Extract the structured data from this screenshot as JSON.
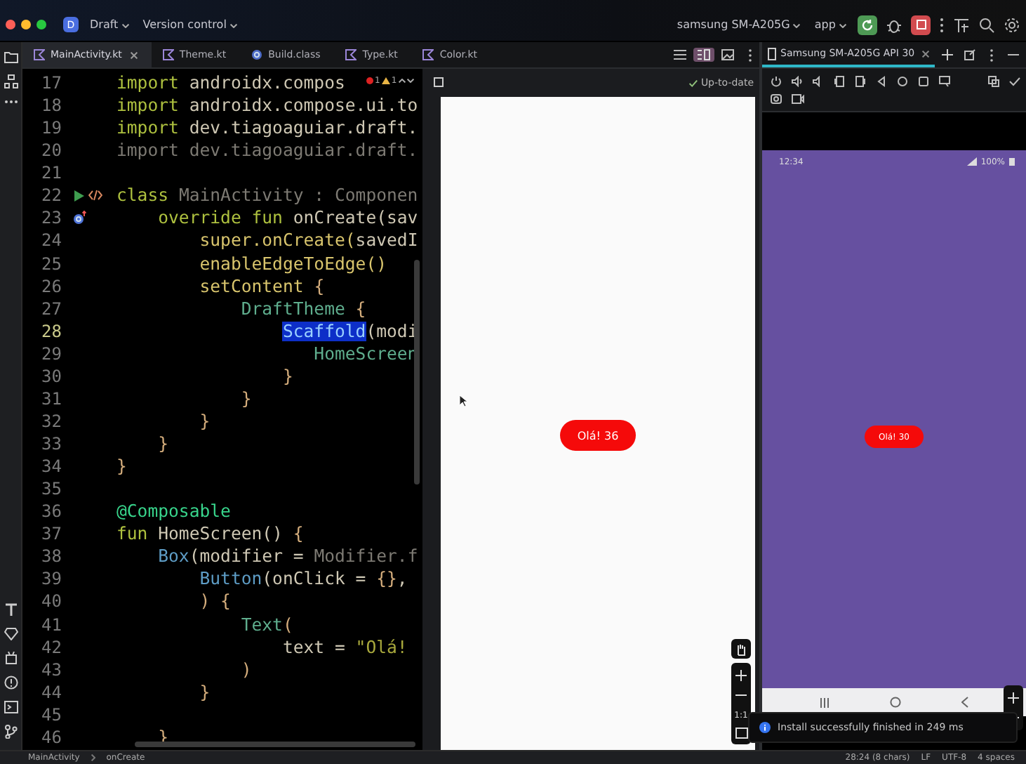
{
  "title_bar": {
    "project_badge": "D",
    "project": "Draft",
    "version_control": "Version control",
    "device": "samsung SM-A205G",
    "config": "app"
  },
  "tabs": [
    {
      "label": "MainActivity.kt",
      "kind": "kotlin",
      "selected": true
    },
    {
      "label": "Theme.kt",
      "kind": "kotlin",
      "selected": false
    },
    {
      "label": "Build.class",
      "kind": "class",
      "selected": false
    },
    {
      "label": "Type.kt",
      "kind": "kotlin",
      "selected": false
    },
    {
      "label": "Color.kt",
      "kind": "kotlin",
      "selected": false
    }
  ],
  "inspections": {
    "errors": "1",
    "warnings": "1"
  },
  "code": [
    {
      "number": "17",
      "tokens": [
        {
          "text": "import",
          "kind": "kw"
        },
        {
          "text": " androidx.compos",
          "kind": "pkg"
        }
      ]
    },
    {
      "number": "18",
      "tokens": [
        {
          "text": "import",
          "kind": "kw"
        },
        {
          "text": " androidx.compose.ui.to",
          "kind": "pkg"
        }
      ]
    },
    {
      "number": "19",
      "tokens": [
        {
          "text": "import",
          "kind": "kw"
        },
        {
          "text": " dev.tiagoaguiar.draft.",
          "kind": "pkg"
        }
      ]
    },
    {
      "number": "20",
      "tokens": [
        {
          "text": "import dev.tiagoaguiar.draft.",
          "kind": "dim"
        }
      ]
    },
    {
      "number": "21",
      "kind": "code"
    },
    {
      "number": "22",
      "kind": "run",
      "tokens": [
        {
          "text": "class",
          "kind": "kw"
        },
        {
          "text": " MainActivity : Componen",
          "kind": "dim"
        }
      ]
    },
    {
      "number": "23",
      "kind": "override",
      "tokens": [
        {
          "text": "    override fun",
          "kind": "kw"
        },
        {
          "text": " onCreate(sav",
          "kind": "pkg"
        }
      ]
    },
    {
      "number": "24",
      "tokens": [
        {
          "text": "        super.onCreate(",
          "kind": "call"
        },
        {
          "text": "savedI",
          "kind": "pkg"
        }
      ]
    },
    {
      "number": "25",
      "tokens": [
        {
          "text": "        enableEdgeToEdge()",
          "kind": "call"
        }
      ]
    },
    {
      "number": "26",
      "tokens": [
        {
          "text": "        setContent",
          "kind": "call"
        },
        {
          "text": " {",
          "kind": "brace"
        }
      ]
    },
    {
      "number": "27",
      "tokens": [
        {
          "text": "            DraftTheme",
          "kind": "comp"
        },
        {
          "text": " {",
          "kind": "brace"
        }
      ]
    },
    {
      "number": "28",
      "tokens": [
        {
          "text": "                Scaffold",
          "kind": "sel"
        },
        {
          "text": "(modi",
          "kind": "pkg"
        }
      ]
    },
    {
      "number": "29",
      "tokens": [
        {
          "text": "                   HomeScreen",
          "kind": "comp"
        }
      ]
    },
    {
      "number": "30",
      "tokens": [
        {
          "text": "                }",
          "kind": "brace"
        }
      ]
    },
    {
      "number": "31",
      "tokens": [
        {
          "text": "            }",
          "kind": "brace"
        }
      ]
    },
    {
      "number": "32",
      "tokens": [
        {
          "text": "        }",
          "kind": "brace"
        }
      ]
    },
    {
      "number": "33",
      "tokens": [
        {
          "text": "    }",
          "kind": "brace"
        }
      ]
    },
    {
      "number": "34",
      "tokens": [
        {
          "text": "}",
          "kind": "brace"
        }
      ]
    },
    {
      "number": "35",
      "kind": "code"
    },
    {
      "number": "36",
      "tokens": [
        {
          "text": "@Composable",
          "kind": "ann"
        }
      ]
    },
    {
      "number": "37",
      "tokens": [
        {
          "text": "fun",
          "kind": "kw"
        },
        {
          "text": " HomeScreen() ",
          "kind": "pkg"
        },
        {
          "text": "{",
          "kind": "brace"
        }
      ]
    },
    {
      "number": "38",
      "tokens": [
        {
          "text": "    Box",
          "kind": "cls"
        },
        {
          "text": "(modifier = ",
          "kind": "pkg"
        },
        {
          "text": "Modifier.f",
          "kind": "dim"
        }
      ]
    },
    {
      "number": "39",
      "tokens": [
        {
          "text": "        Button",
          "kind": "cls"
        },
        {
          "text": "(onClick = ",
          "kind": "pkg"
        },
        {
          "text": "{}",
          "kind": "brace"
        },
        {
          "text": ",",
          "kind": "pkg"
        }
      ]
    },
    {
      "number": "40",
      "tokens": [
        {
          "text": "        ) {",
          "kind": "brace"
        }
      ]
    },
    {
      "number": "41",
      "tokens": [
        {
          "text": "            Text",
          "kind": "comp"
        },
        {
          "text": "(",
          "kind": "brace"
        }
      ]
    },
    {
      "number": "42",
      "tokens": [
        {
          "text": "                text = ",
          "kind": "pkg"
        },
        {
          "text": "\"Olá!",
          "kind": "str"
        }
      ]
    },
    {
      "number": "43",
      "tokens": [
        {
          "text": "            )",
          "kind": "brace"
        }
      ]
    },
    {
      "number": "44",
      "tokens": [
        {
          "text": "        }",
          "kind": "brace"
        }
      ]
    },
    {
      "number": "45",
      "kind": "code"
    },
    {
      "number": "46",
      "tokens": [
        {
          "text": "    }",
          "kind": "brace"
        }
      ]
    }
  ],
  "preview": {
    "status": "Up-to-date",
    "button": "Olá! 36",
    "zoom_reset": "1:1"
  },
  "device_panel": {
    "tab": "Samsung SM-A205G API 30",
    "clock": "12:34",
    "battery": "100%",
    "button": "Olá! 30"
  },
  "toast": "Install successfully finished in 249 ms",
  "status_bar": {
    "breadcrumbs": [
      "MainActivity",
      "onCreate"
    ],
    "position": "28:24 (8 chars)",
    "line_ending": "LF",
    "encoding": "UTF-8",
    "indent": "4 spaces"
  }
}
